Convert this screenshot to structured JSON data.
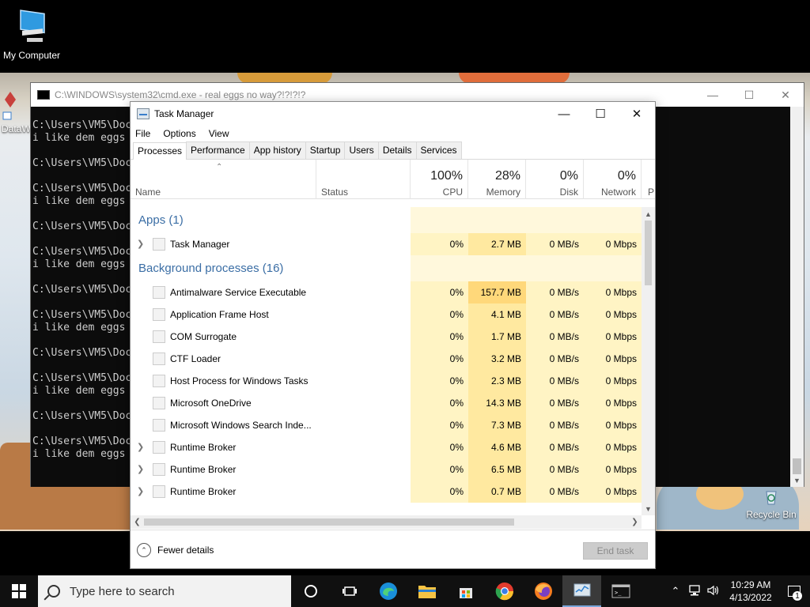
{
  "desktop": {
    "icons": [
      {
        "label": "My Computer"
      },
      {
        "label": "Recycle Bin"
      },
      {
        "label": "DataW"
      }
    ]
  },
  "cmd": {
    "title": "C:\\WINDOWS\\system32\\cmd.exe - real  eggs no way?!?!?!?",
    "lines": [
      "C:\\Users\\VM5\\Doc",
      "i like dem eggs",
      "",
      "C:\\Users\\VM5\\Doc",
      "",
      "C:\\Users\\VM5\\Doc",
      "i like dem eggs",
      "",
      "C:\\Users\\VM5\\Doc",
      "",
      "C:\\Users\\VM5\\Doc",
      "i like dem eggs",
      "",
      "C:\\Users\\VM5\\Doc",
      "",
      "C:\\Users\\VM5\\Doc",
      "i like dem eggs",
      "",
      "C:\\Users\\VM5\\Doc",
      "",
      "C:\\Users\\VM5\\Doc",
      "i like dem eggs",
      "",
      "C:\\Users\\VM5\\Doc",
      "",
      "C:\\Users\\VM5\\Doc",
      "i like dem eggs"
    ]
  },
  "taskmgr": {
    "title": "Task Manager",
    "menu": [
      "File",
      "Options",
      "View"
    ],
    "tabs": [
      "Processes",
      "Performance",
      "App history",
      "Startup",
      "Users",
      "Details",
      "Services"
    ],
    "active_tab": "Processes",
    "columns": {
      "name": "Name",
      "status": "Status",
      "cpu": {
        "pct": "100%",
        "label": "CPU"
      },
      "memory": {
        "pct": "28%",
        "label": "Memory"
      },
      "disk": {
        "pct": "0%",
        "label": "Disk"
      },
      "network": {
        "pct": "0%",
        "label": "Network"
      },
      "power": {
        "label": "P"
      }
    },
    "groups": {
      "apps": "Apps (1)",
      "background": "Background processes (16)"
    },
    "apps": [
      {
        "name": "Task Manager",
        "cpu": "0%",
        "memory": "2.7 MB",
        "disk": "0 MB/s",
        "network": "0 Mbps",
        "expandable": true
      }
    ],
    "background": [
      {
        "name": "Antimalware Service Executable",
        "cpu": "0%",
        "memory": "157.7 MB",
        "disk": "0 MB/s",
        "network": "0 Mbps",
        "expandable": false
      },
      {
        "name": "Application Frame Host",
        "cpu": "0%",
        "memory": "4.1 MB",
        "disk": "0 MB/s",
        "network": "0 Mbps",
        "expandable": false
      },
      {
        "name": "COM Surrogate",
        "cpu": "0%",
        "memory": "1.7 MB",
        "disk": "0 MB/s",
        "network": "0 Mbps",
        "expandable": false
      },
      {
        "name": "CTF Loader",
        "cpu": "0%",
        "memory": "3.2 MB",
        "disk": "0 MB/s",
        "network": "0 Mbps",
        "expandable": false
      },
      {
        "name": "Host Process for Windows Tasks",
        "cpu": "0%",
        "memory": "2.3 MB",
        "disk": "0 MB/s",
        "network": "0 Mbps",
        "expandable": false
      },
      {
        "name": "Microsoft OneDrive",
        "cpu": "0%",
        "memory": "14.3 MB",
        "disk": "0 MB/s",
        "network": "0 Mbps",
        "expandable": false
      },
      {
        "name": "Microsoft Windows Search Inde...",
        "cpu": "0%",
        "memory": "7.3 MB",
        "disk": "0 MB/s",
        "network": "0 Mbps",
        "expandable": false
      },
      {
        "name": "Runtime Broker",
        "cpu": "0%",
        "memory": "4.6 MB",
        "disk": "0 MB/s",
        "network": "0 Mbps",
        "expandable": true
      },
      {
        "name": "Runtime Broker",
        "cpu": "0%",
        "memory": "6.5 MB",
        "disk": "0 MB/s",
        "network": "0 Mbps",
        "expandable": true
      },
      {
        "name": "Runtime Broker",
        "cpu": "0%",
        "memory": "0.7 MB",
        "disk": "0 MB/s",
        "network": "0 Mbps",
        "expandable": true
      }
    ],
    "footer": {
      "fewer_details": "Fewer details",
      "end_task": "End task"
    }
  },
  "taskbar": {
    "search_placeholder": "Type here to search",
    "pinned": [
      "task-view-icon",
      "edge-icon",
      "file-explorer-icon",
      "store-icon",
      "chrome-icon",
      "firefox-icon",
      "task-manager-icon",
      "cmd-icon"
    ],
    "time": "10:29 AM",
    "date": "4/13/2022",
    "notification_count": "1"
  },
  "colors": {
    "group_heading": "#3b6ea5",
    "heat_light": "#fff4c4",
    "heat_medium": "#ffe9a0",
    "heat_strong": "#ffd87a"
  }
}
